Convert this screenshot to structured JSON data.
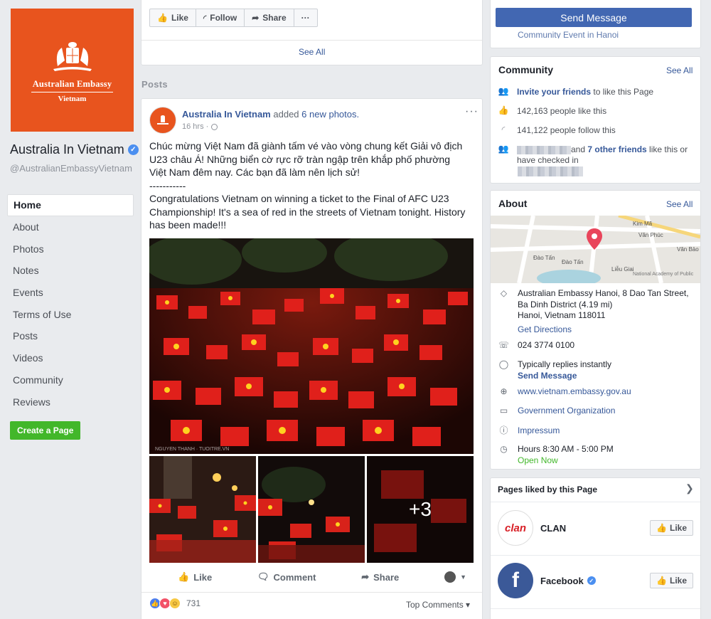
{
  "page": {
    "logo": {
      "title": "Australian Embassy",
      "subtitle": "Vietnam"
    },
    "name": "Australia In Vietnam",
    "handle": "@AustralianEmbassyVietnam"
  },
  "nav": {
    "items": [
      "Home",
      "About",
      "Photos",
      "Notes",
      "Events",
      "Terms of Use",
      "Posts",
      "Videos",
      "Community",
      "Reviews"
    ],
    "create_page": "Create a Page"
  },
  "top_actions": {
    "like": "Like",
    "follow": "Follow",
    "share": "Share",
    "more": "···"
  },
  "top_card": {
    "see_all": "See All"
  },
  "posts_heading": "Posts",
  "post": {
    "author": "Australia In Vietnam",
    "verb": "added",
    "photos_link": "6 new photos.",
    "time": "16 hrs ·",
    "more": "···",
    "text": "Chúc mừng Việt Nam đã giành tấm vé vào vòng chung kết Giải vô địch U23 châu Á! Những biển cờ rực rỡ tràn ngập trên khắp phố phường Việt Nam đêm nay. Các bạn đã làm nên lịch sử!\n-----------\nCongratulations Vietnam on winning a ticket to the Final of AFC U23 Championship! It's a sea of red in the streets of Vietnam tonight. History has been made!!!",
    "photo_credit": "NGUYEN THANH · TUOITRE.VN",
    "more_photos": "+3",
    "actions": {
      "like": "Like",
      "comment": "Comment",
      "share": "Share"
    },
    "reaction_count": "731",
    "top_comments": "Top Comments ▾"
  },
  "right": {
    "send_message": "Send Message",
    "faded": "Community Event in Hanoi",
    "community": {
      "title": "Community",
      "see_all": "See All",
      "invite_link": "Invite your friends",
      "invite_rest": " to like this Page",
      "likes": "142,163 people like this",
      "follows": "141,122 people follow this",
      "friends_and": "and ",
      "friends_link": "7 other friends",
      "friends_rest": " like this or",
      "checked_in": "have checked in"
    },
    "about": {
      "title": "About",
      "see_all": "See All",
      "map_labels": {
        "street1": "Đào Tấn",
        "street2": "Đào Tấn",
        "street3": "Kim Mã",
        "street4": "Văn Phúc",
        "street5": "Liễu Giai",
        "street6": "Văn Bảo",
        "poi": "National Academy of Public",
        "street7": "Kim Mã"
      },
      "address_line1": "Australian Embassy Hanoi, 8 Dao Tan Street,",
      "address_line2": "Ba Dinh District (4.19 mi)",
      "address_line3": "Hanoi, Vietnam 118011",
      "directions": "Get Directions",
      "phone": "024 3774 0100",
      "replies": "Typically replies instantly",
      "send_message": "Send Message",
      "website": "www.vietnam.embassy.gov.au",
      "category": "Government Organization",
      "impressum": "Impressum",
      "hours": "Hours 8:30 AM - 5:00 PM",
      "open_now": "Open Now"
    },
    "pages_liked": {
      "title": "Pages liked by this Page",
      "items": [
        {
          "name": "CLAN",
          "logo_text": "clan",
          "like": "Like"
        },
        {
          "name": "Facebook",
          "logo_text": "f",
          "like": "Like"
        }
      ]
    }
  },
  "colors": {
    "brand_orange": "#e8541e",
    "fb_blue": "#4267b2",
    "link_blue": "#365899",
    "green": "#42b72a"
  }
}
